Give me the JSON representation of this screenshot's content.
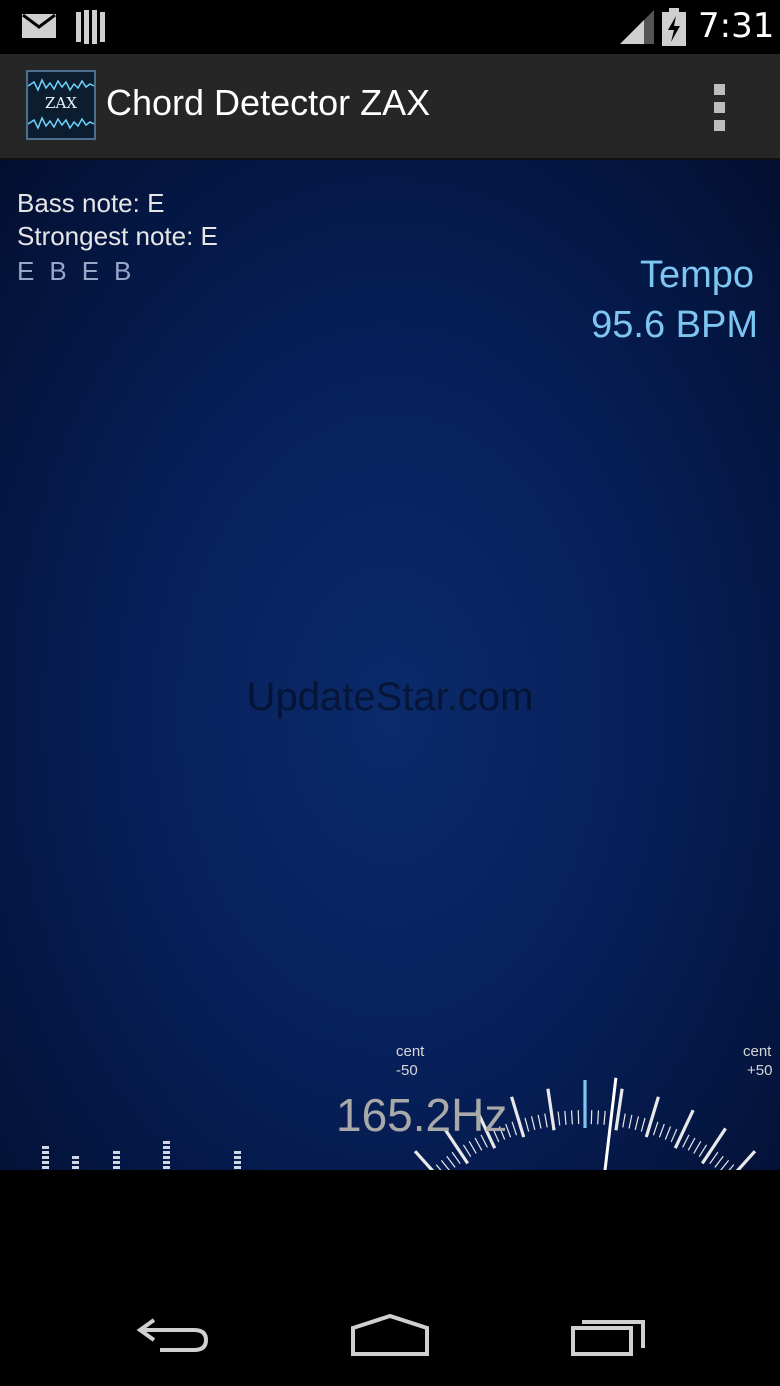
{
  "status_bar": {
    "time": "7:31",
    "icons": [
      "mail-icon",
      "barcode-icon",
      "signal-icon",
      "battery-charging-icon"
    ]
  },
  "action_bar": {
    "title": "Chord Detector ZAX",
    "app_icon_text": "ZAX",
    "overflow_icon": "overflow-menu-icon"
  },
  "notes_info": {
    "bass": "Bass note: E",
    "strongest": "Strongest note: E",
    "sequence": [
      "E",
      "B",
      "E",
      "B"
    ]
  },
  "tempo": {
    "label": "Tempo",
    "value": "95.6 BPM"
  },
  "watermark": "UpdateStar.com",
  "tuner": {
    "left_label": "cent",
    "left_value": "-50",
    "right_label": "cent",
    "right_value": "+50",
    "frequency": "165.2Hz",
    "needle_cents": 8
  },
  "nav_bar": {
    "icons": [
      "back-icon",
      "home-icon",
      "recent-apps-icon"
    ]
  },
  "colors": {
    "background": "#06205a",
    "tempo_text": "#7ec6f2",
    "action_bar": "#262626"
  }
}
